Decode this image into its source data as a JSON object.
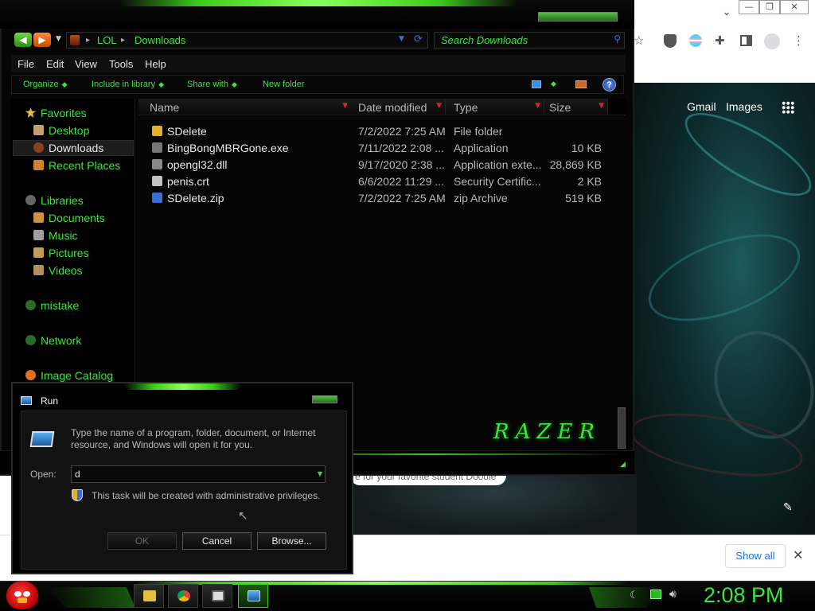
{
  "browser": {
    "window_controls": [
      "—",
      "❐",
      "✕"
    ],
    "tab_dropdown": "⌄",
    "google_links": [
      "Gmail",
      "Images"
    ],
    "doodle_snippet": "e for your favorite student Doodle",
    "downloads_bar": {
      "show_all": "Show all",
      "close": "✕"
    },
    "icons": [
      "star-icon",
      "ublock-icon",
      "translate-icon",
      "extensions-icon",
      "sidepanel-icon",
      "profile-icon",
      "kebab-menu-icon",
      "apps-grid-icon",
      "pencil-icon"
    ]
  },
  "explorer": {
    "address": {
      "segments": [
        "LOL",
        "Downloads"
      ]
    },
    "search_placeholder": "Search Downloads",
    "menu": [
      "File",
      "Edit",
      "View",
      "Tools",
      "Help"
    ],
    "commands": [
      "Organize",
      "Include in library",
      "Share with",
      "New folder"
    ],
    "help_label": "?",
    "nav": [
      {
        "label": "Favorites",
        "icon": "star-icon",
        "color": "#e0c040"
      },
      {
        "label": "Desktop",
        "icon": "desktop-icon",
        "color": "#c0a070"
      },
      {
        "label": "Downloads",
        "icon": "downloads-icon",
        "color": "#8a4020"
      },
      {
        "label": "Recent Places",
        "icon": "recent-places-icon",
        "color": "#d08030"
      },
      {
        "label": "Libraries",
        "icon": "libraries-icon",
        "color": "#666666"
      },
      {
        "label": "Documents",
        "icon": "documents-icon",
        "color": "#d09040"
      },
      {
        "label": "Music",
        "icon": "music-icon",
        "color": "#a0a0a0"
      },
      {
        "label": "Pictures",
        "icon": "pictures-icon",
        "color": "#c0a050"
      },
      {
        "label": "Videos",
        "icon": "videos-icon",
        "color": "#b09060"
      },
      {
        "label": "mistake",
        "icon": "homegroup-icon",
        "color": "#2a6a2a"
      },
      {
        "label": "Network",
        "icon": "network-icon",
        "color": "#2a6a2a"
      },
      {
        "label": "Image Catalog",
        "icon": "image-catalog-icon",
        "color": "#e07020"
      }
    ],
    "selected_nav": "Downloads",
    "columns": [
      "Name",
      "Date modified",
      "Type",
      "Size"
    ],
    "files": [
      {
        "name": "SDelete",
        "date": "7/2/2022 7:25 AM",
        "type": "File folder",
        "size": "",
        "icon": "folder-icon",
        "color": "#e0b030"
      },
      {
        "name": "BingBongMBRGone.exe",
        "date": "7/11/2022 2:08 ...",
        "type": "Application",
        "size": "10 KB",
        "icon": "exe-icon",
        "color": "#777777"
      },
      {
        "name": "opengl32.dll",
        "date": "9/17/2020 2:38 ...",
        "type": "Application exte...",
        "size": "28,869 KB",
        "icon": "dll-icon",
        "color": "#888888"
      },
      {
        "name": "penis.crt",
        "date": "6/6/2022 11:29 ...",
        "type": "Security Certific...",
        "size": "2 KB",
        "icon": "certificate-icon",
        "color": "#c0c0c0"
      },
      {
        "name": "SDelete.zip",
        "date": "7/2/2022 7:25 AM",
        "type": "zip Archive",
        "size": "519 KB",
        "icon": "zip-icon",
        "color": "#3b6fd8"
      }
    ],
    "logo_text": "RAZER"
  },
  "run": {
    "title": "Run",
    "description": "Type the name of a program, folder, document, or Internet resource, and Windows will open it for you.",
    "open_label": "Open:",
    "input_value": "d",
    "admin_note": "This task will be created with administrative privileges.",
    "buttons": {
      "ok": "OK",
      "cancel": "Cancel",
      "browse": "Browse..."
    }
  },
  "taskbar": {
    "clock": "2:08 PM",
    "pinned": [
      "file-explorer-icon",
      "chrome-icon",
      "window-icon",
      "run-icon"
    ],
    "tray": [
      "moon-icon",
      "network-icon",
      "volume-icon"
    ]
  },
  "colors": {
    "accent": "#3ee43e",
    "glow": "#3ccd1c",
    "bg": "#000000"
  }
}
